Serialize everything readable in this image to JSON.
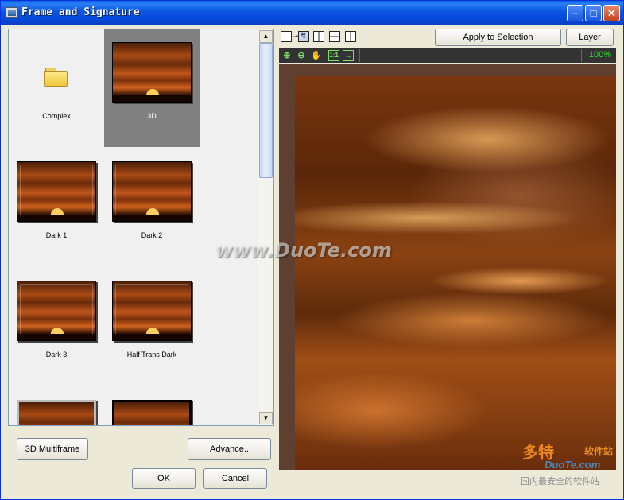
{
  "window": {
    "title": "Frame and Signature"
  },
  "gallery": {
    "items": [
      {
        "label": "Complex",
        "kind": "folder",
        "selected": false
      },
      {
        "label": "3D",
        "kind": "frame",
        "selected": true
      },
      {
        "label": "Dark 1",
        "kind": "frame",
        "selected": false
      },
      {
        "label": "Dark 2",
        "kind": "frame",
        "selected": false
      },
      {
        "label": "Dark 3",
        "kind": "frame",
        "selected": false
      },
      {
        "label": "Half Trans Dark",
        "kind": "frame",
        "selected": false
      },
      {
        "label": "",
        "kind": "frame",
        "selected": false
      },
      {
        "label": "",
        "kind": "frame",
        "selected": false
      }
    ]
  },
  "buttons": {
    "multiframe": "3D Multiframe",
    "advance": "Advance..",
    "ok": "OK",
    "cancel": "Cancel",
    "apply_selection": "Apply to Selection",
    "layer": "Layer"
  },
  "preview": {
    "zoom": "100%"
  },
  "watermark": {
    "site": "www.DuoTe.com",
    "logo_main": "多特",
    "logo_sub": "软件站",
    "logo_site": "DuoTe.com",
    "logo_slogan": "国内最安全的软件站"
  }
}
